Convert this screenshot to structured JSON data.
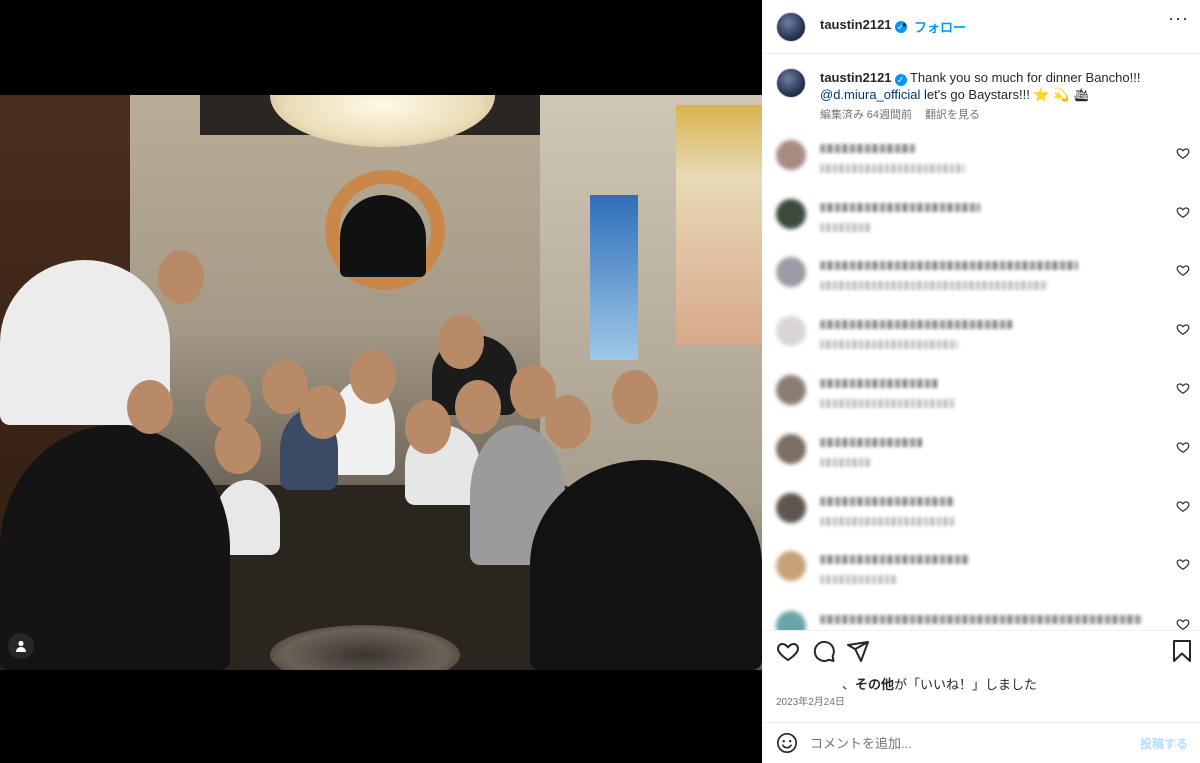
{
  "header": {
    "username": "taustin2121",
    "separator": "•",
    "follow_label": "フォロー",
    "more_label": "···"
  },
  "caption": {
    "username": "taustin2121",
    "text_line1": "Thank you so much for dinner Bancho!!!",
    "mention": "@d.miura_official",
    "text_line2": "let's go Baystars!!! ⭐ 💫 🛳",
    "edited": "編集済み",
    "time_ago": "64週間前",
    "translate": "翻訳を見る"
  },
  "comments": {
    "items": [
      {
        "avatar_color": "#a88a82"
      },
      {
        "avatar_color": "#3b4a3c"
      },
      {
        "avatar_color": "#9c9aa2"
      },
      {
        "avatar_color": "#d9d4d8"
      },
      {
        "avatar_color": "#8c7d72"
      },
      {
        "avatar_color": "#7c6e62"
      },
      {
        "avatar_color": "#5f564f"
      },
      {
        "avatar_color": "#c7a277"
      },
      {
        "avatar_color": "#69a5a8"
      }
    ]
  },
  "likes": {
    "comma": "、",
    "others": "その他",
    "suffix": "が「いいね！」しました"
  },
  "date": "2023年2月24日",
  "add_comment": {
    "placeholder": "コメントを追加...",
    "post_label": "投稿する"
  },
  "colors": {
    "accent": "#0095f6",
    "verified": "#0095f6",
    "post_disabled": "#b2dffc",
    "text_secondary": "#737373"
  },
  "icons": {
    "heart": "heart-icon",
    "comment": "comment-icon",
    "share": "paper-plane-icon",
    "save": "bookmark-icon",
    "emoji": "smiley-icon",
    "user_tag": "person-icon"
  }
}
